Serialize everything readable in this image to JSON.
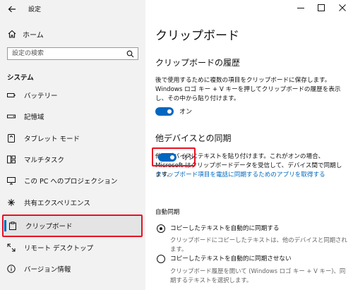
{
  "window": {
    "title": "設定"
  },
  "sidebar": {
    "home_label": "ホーム",
    "search_placeholder": "設定の検索",
    "section_title": "システム",
    "items": [
      {
        "label": "バッテリー"
      },
      {
        "label": "記憶域"
      },
      {
        "label": "タブレット モード"
      },
      {
        "label": "マルチタスク"
      },
      {
        "label": "この PC へのプロジェクション"
      },
      {
        "label": "共有エクスペリエンス"
      },
      {
        "label": "クリップボード"
      },
      {
        "label": "リモート デスクトップ"
      },
      {
        "label": "バージョン情報"
      }
    ],
    "selected_index": 6
  },
  "main": {
    "title": "クリップボード",
    "history": {
      "heading": "クリップボードの履歴",
      "desc": "後で使用するために複数の項目をクリップボードに保存します。Windows ロゴ キー + V キーを押してクリップボードの履歴を表示し、その中から貼り付けます。",
      "toggle_label": "オン",
      "toggle_on": true
    },
    "sync": {
      "heading": "他デバイスとの同期",
      "desc": "他のデバイスにテキストを貼り付けます。これがオンの場合、Microsoft はクリップボードデータを受信して、デバイス間で同期します。",
      "toggle_label": "オン",
      "toggle_on": true,
      "link": "クリップボード項目を電話に同期するためのアプリを取得する",
      "auto_sync_title": "自動同期",
      "options": [
        {
          "label": "コピーしたテキストを自動的に同期する",
          "desc": "クリップボードにコピーしたテキストは、他のデバイスと同期されます。",
          "selected": true
        },
        {
          "label": "コピーしたテキストを自動的に同期させない",
          "desc": "クリップボード履歴を開いて (Windows ロゴ キー + V キー)、同期するテキストを選択します。",
          "selected": false
        }
      ]
    }
  },
  "colors": {
    "accent": "#0067c0",
    "highlight": "#e81123",
    "sidebar_bg": "#f2f2f2"
  }
}
